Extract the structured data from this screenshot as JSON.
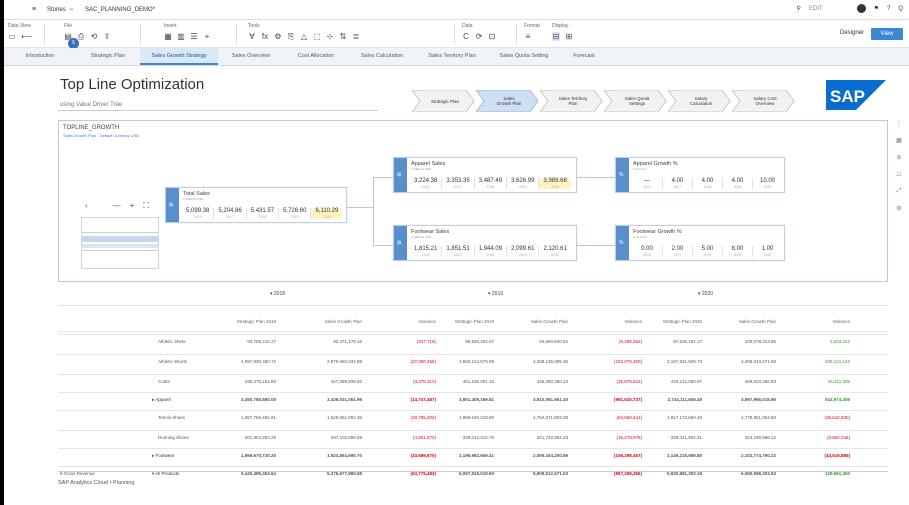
{
  "shell": {
    "menu_icon": "menu-icon",
    "breadcrumb_root": "Stories",
    "breadcrumb_sep": "»",
    "story_name": "SAC_PLANNING_DEMO*",
    "search_placeholder": "EDIT",
    "zoom": "Q"
  },
  "toolbar": {
    "groups": [
      {
        "label": "Data View",
        "icons": [
          "▭",
          "⟵"
        ]
      },
      {
        "label": "File",
        "icons": [
          "▤",
          "⎙",
          "⟲",
          "⇪"
        ]
      },
      {
        "label": "Insert",
        "icons": [
          "▦",
          "▥",
          "☰",
          "+"
        ]
      },
      {
        "label": "Tools",
        "icons": [
          "∀",
          "fx",
          "⚙",
          "⎘",
          "△",
          "⬚",
          "⊹",
          "⇅",
          "≣"
        ]
      },
      {
        "label": "Data",
        "icons": [
          "C",
          "⟳",
          "⊡"
        ]
      },
      {
        "label": "Format",
        "icons": [
          "≡"
        ]
      },
      {
        "label": "Display",
        "icons": [
          "⊟",
          "⊞"
        ]
      }
    ],
    "designer_label": "Designer",
    "view_label": "View",
    "profile_initials": "6"
  },
  "tabs": [
    {
      "label": "Introduction",
      "active": false
    },
    {
      "label": "Strategic Plan",
      "active": false
    },
    {
      "label": "Sales Growth Strategy",
      "active": true
    },
    {
      "label": "Sales Overview",
      "active": false
    },
    {
      "label": "Cost Allocation",
      "active": false
    },
    {
      "label": "Sales Calculation",
      "active": false
    },
    {
      "label": "Sales Territory Plan",
      "active": false
    },
    {
      "label": "Sales Quota Setting",
      "active": false
    },
    {
      "label": "Forecast",
      "active": false
    }
  ],
  "page": {
    "title": "Top Line Optimization",
    "subtitle": "using Value Driver Tree",
    "footer": "SAP Analytics Cloud • Planning",
    "logo": "SAP"
  },
  "process": [
    {
      "label": "Strategic Plan",
      "active": false
    },
    {
      "label": "Sales Growth Plan",
      "active": true
    },
    {
      "label": "Sales Territory Plan",
      "active": false
    },
    {
      "label": "Sales Quota Settings",
      "active": false
    },
    {
      "label": "Salary Calculation",
      "active": false
    },
    {
      "label": "Salary Cost Overview",
      "active": false
    }
  ],
  "vdt": {
    "title": "TOPLINE_GROWTH",
    "subtitle": "Sales Growth Plan · Default Currency USD",
    "nodes": {
      "total": {
        "title": "Total Sales",
        "sub": "in Millions USD",
        "values": [
          "5,099.38",
          "5,204.86",
          "5,431.57",
          "5,726.60",
          "6,110.29"
        ],
        "years": [
          "2016",
          "2017",
          "2018",
          "2019",
          "2020"
        ]
      },
      "apparel": {
        "title": "Apparel Sales",
        "sub": "in Millions USD",
        "values": [
          "3,224.38",
          "3,353.35",
          "3,487.49",
          "3,626.99",
          "3,989.68"
        ],
        "years": [
          "2016",
          "2017",
          "2018",
          "2019",
          "2020"
        ]
      },
      "footwear": {
        "title": "Footwear Sales",
        "sub": "in Millions USD",
        "values": [
          "1,815.21",
          "1,851.51",
          "1,944.09",
          "2,099.61",
          "2,120.61"
        ],
        "years": [
          "2016",
          "2017",
          "2018",
          "2019",
          "2020"
        ]
      },
      "apparel_growth": {
        "title": "Apparel Growth %",
        "sub": "in Percent",
        "values": [
          "—",
          "4.00",
          "4.00",
          "4.00",
          "10.00"
        ],
        "years": [
          "2016",
          "2017",
          "2018",
          "2019",
          "2020"
        ]
      },
      "footwear_growth": {
        "title": "Footwear Growth %",
        "sub": "in Percent",
        "values": [
          "0.00",
          "2.00",
          "5.00",
          "8.00",
          "1.00"
        ],
        "years": [
          "2016",
          "2017",
          "2018",
          "2019",
          "2020"
        ]
      }
    },
    "controls": {
      "back": "‹",
      "minus": "—",
      "plus": "+",
      "fit": "⛶"
    }
  },
  "table": {
    "years": [
      "▾ 2018",
      "▾ 2019",
      "▾ 2020"
    ],
    "col_headers": [
      "Strategic Plan 2018",
      "Sales Growth Plan",
      "Variance",
      "Strategic Plan 2019",
      "Sales Growth Plan",
      "Variance",
      "Strategic Plan 2020",
      "Sales Growth Plan",
      "Variance"
    ],
    "rows": [
      {
        "l1": "",
        "l2": "Athletic Shirts",
        "vals": [
          "92,789,210.27",
          "92,471,179.16",
          "(317,716)",
          "99,930,202.57",
          "94,660,940.94",
          "(5,269,262)",
          "97,535,162.17",
          "100,078,313.96",
          "2,543,152"
        ],
        "sign": [
          "",
          "",
          "neg",
          "",
          "",
          "neg",
          "",
          "",
          "pos"
        ]
      },
      {
        "l1": "",
        "l2": "Athletic Shorts",
        "vals": [
          "2,997,830,490.72",
          "2,970,660,034.99",
          "(27,000,456)",
          "3,560,214,579.09",
          "3,338,135,089.36",
          "(222,079,490)",
          "3,197,921,929.73",
          "3,406,043,071.69",
          "208,121,142"
        ],
        "sign": [
          "",
          "",
          "neg",
          "",
          "",
          "neg",
          "",
          "",
          "pos"
        ]
      },
      {
        "l1": "",
        "l2": "Coats",
        "vals": [
          "430,476,151.60",
          "427,099,839.82",
          "(3,376,312)",
          "461,156,001.12",
          "445,280,360.13",
          "(15,875,641)",
          "443,212,060.97",
          "469,623,366.93",
          "26,411,306"
        ],
        "sign": [
          "",
          "",
          "neg",
          "",
          "",
          "neg",
          "",
          "",
          "pos"
        ]
      },
      {
        "l1": "",
        "l2": "▸ Apparel",
        "vals": [
          "3,450,780,580.00",
          "3,436,031,051.96",
          "(14,747,487)",
          "3,901,409,169.81",
          "3,910,061,661.40",
          "(991,620,737)",
          "3,744,111,608.49",
          "3,997,966,015.95",
          "543,974,356"
        ],
        "sign": [
          "",
          "",
          "neg",
          "",
          "",
          "neg",
          "",
          "",
          "pos"
        ],
        "bold": true
      },
      {
        "l1": "",
        "l2": "Tennis Shoes",
        "vals": [
          "1,657,766,456.91",
          "1,629,061,093.36",
          "(28,705,402)",
          "1,858,640,243.80",
          "1,764,071,803.38",
          "(94,568,441)",
          "1,817,172,660.49",
          "1,778,951,054.50",
          "(38,642,830)"
        ],
        "sign": [
          "",
          "",
          "neg",
          "",
          "",
          "neg",
          "",
          "",
          "neg"
        ]
      },
      {
        "l1": "",
        "l2": "Running Shoes",
        "vals": [
          "301,904,263.28",
          "297,102,595.59",
          "(4,801,672)",
          "338,012,312.79",
          "321,742,554.33",
          "(16,279,978)",
          "328,041,904.31",
          "324,189,886.12",
          "(3,852,046)"
        ],
        "sign": [
          "",
          "",
          "neg",
          "",
          "",
          "neg",
          "",
          "",
          "neg"
        ]
      },
      {
        "l1": "",
        "l2": "▸ Footwear",
        "vals": [
          "1,959,670,720.20",
          "1,924,864,690.70",
          "(33,689,970)",
          "2,196,962,659.41",
          "2,090,164,200.56",
          "(106,298,457)",
          "2,146,215,589.80",
          "2,102,774,790.22",
          "(43,516,885)"
        ],
        "sign": [
          "",
          "",
          "neg",
          "",
          "",
          "neg",
          "",
          "",
          "neg"
        ],
        "bold": true
      },
      {
        "l1": "▾ Gross Revenue",
        "l2": "▾ All Products",
        "vals": [
          "5,440,495,363.64",
          "5,376,677,880.59",
          "(63,775,483)",
          "6,097,919,019.60",
          "5,909,512,671.03",
          "(997,299,356)",
          "5,930,881,393.19",
          "6,060,598,303.93",
          "129,661,360"
        ],
        "sign": [
          "",
          "",
          "neg",
          "",
          "",
          "neg",
          "",
          "",
          "pos"
        ],
        "bold": true
      }
    ]
  }
}
